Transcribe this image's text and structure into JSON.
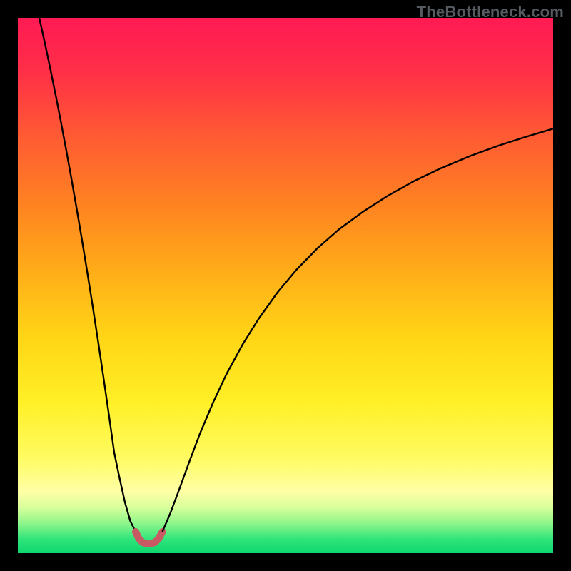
{
  "watermark": "TheBottleneck.com",
  "chart_data": {
    "type": "line",
    "title": "",
    "xlabel": "",
    "ylabel": "",
    "xlim": [
      0,
      100
    ],
    "ylim": [
      0,
      100
    ],
    "background_gradient_stops": [
      {
        "offset": 0.0,
        "color": "#ff1a54"
      },
      {
        "offset": 0.1,
        "color": "#ff2f47"
      },
      {
        "offset": 0.22,
        "color": "#ff5a33"
      },
      {
        "offset": 0.35,
        "color": "#ff8321"
      },
      {
        "offset": 0.48,
        "color": "#ffaf18"
      },
      {
        "offset": 0.6,
        "color": "#ffd616"
      },
      {
        "offset": 0.72,
        "color": "#fff028"
      },
      {
        "offset": 0.82,
        "color": "#fffb60"
      },
      {
        "offset": 0.885,
        "color": "#ffffa6"
      },
      {
        "offset": 0.915,
        "color": "#d8ff9a"
      },
      {
        "offset": 0.945,
        "color": "#8cf58a"
      },
      {
        "offset": 0.975,
        "color": "#2de47a"
      },
      {
        "offset": 1.0,
        "color": "#0fd66e"
      }
    ],
    "series": [
      {
        "name": "left-branch",
        "stroke": "#000000",
        "stroke_width": 2.4,
        "x": [
          4.0,
          5.0,
          6.0,
          7.0,
          8.0,
          9.0,
          10.0,
          11.0,
          12.0,
          13.0,
          14.0,
          15.0,
          16.0,
          17.0,
          18.0,
          19.0,
          20.0,
          21.0,
          22.0
        ],
        "y": [
          100.0,
          95.5,
          90.8,
          85.9,
          80.8,
          75.5,
          70.0,
          64.3,
          58.4,
          52.3,
          46.0,
          39.5,
          32.8,
          25.9,
          18.8,
          14.0,
          9.5,
          6.0,
          4.0
        ]
      },
      {
        "name": "valley-floor",
        "stroke": "#c85a63",
        "stroke_width": 10,
        "linecap": "round",
        "x": [
          22.0,
          22.6,
          23.3,
          24.0,
          24.8,
          25.6,
          26.3,
          27.0
        ],
        "y": [
          4.0,
          2.7,
          2.0,
          1.8,
          1.8,
          2.0,
          2.7,
          4.0
        ]
      },
      {
        "name": "right-branch",
        "stroke": "#000000",
        "stroke_width": 2.4,
        "x": [
          27.0,
          28.5,
          30.0,
          32.0,
          34.0,
          36.5,
          39.0,
          42.0,
          45.0,
          48.5,
          52.0,
          56.0,
          60.0,
          64.5,
          69.0,
          74.0,
          79.0,
          84.5,
          90.0,
          95.0,
          100.0
        ],
        "y": [
          4.0,
          7.5,
          11.5,
          17.0,
          22.3,
          28.2,
          33.5,
          39.0,
          43.8,
          48.7,
          52.9,
          57.0,
          60.5,
          63.8,
          66.7,
          69.5,
          71.9,
          74.2,
          76.2,
          77.8,
          79.3
        ]
      }
    ]
  }
}
